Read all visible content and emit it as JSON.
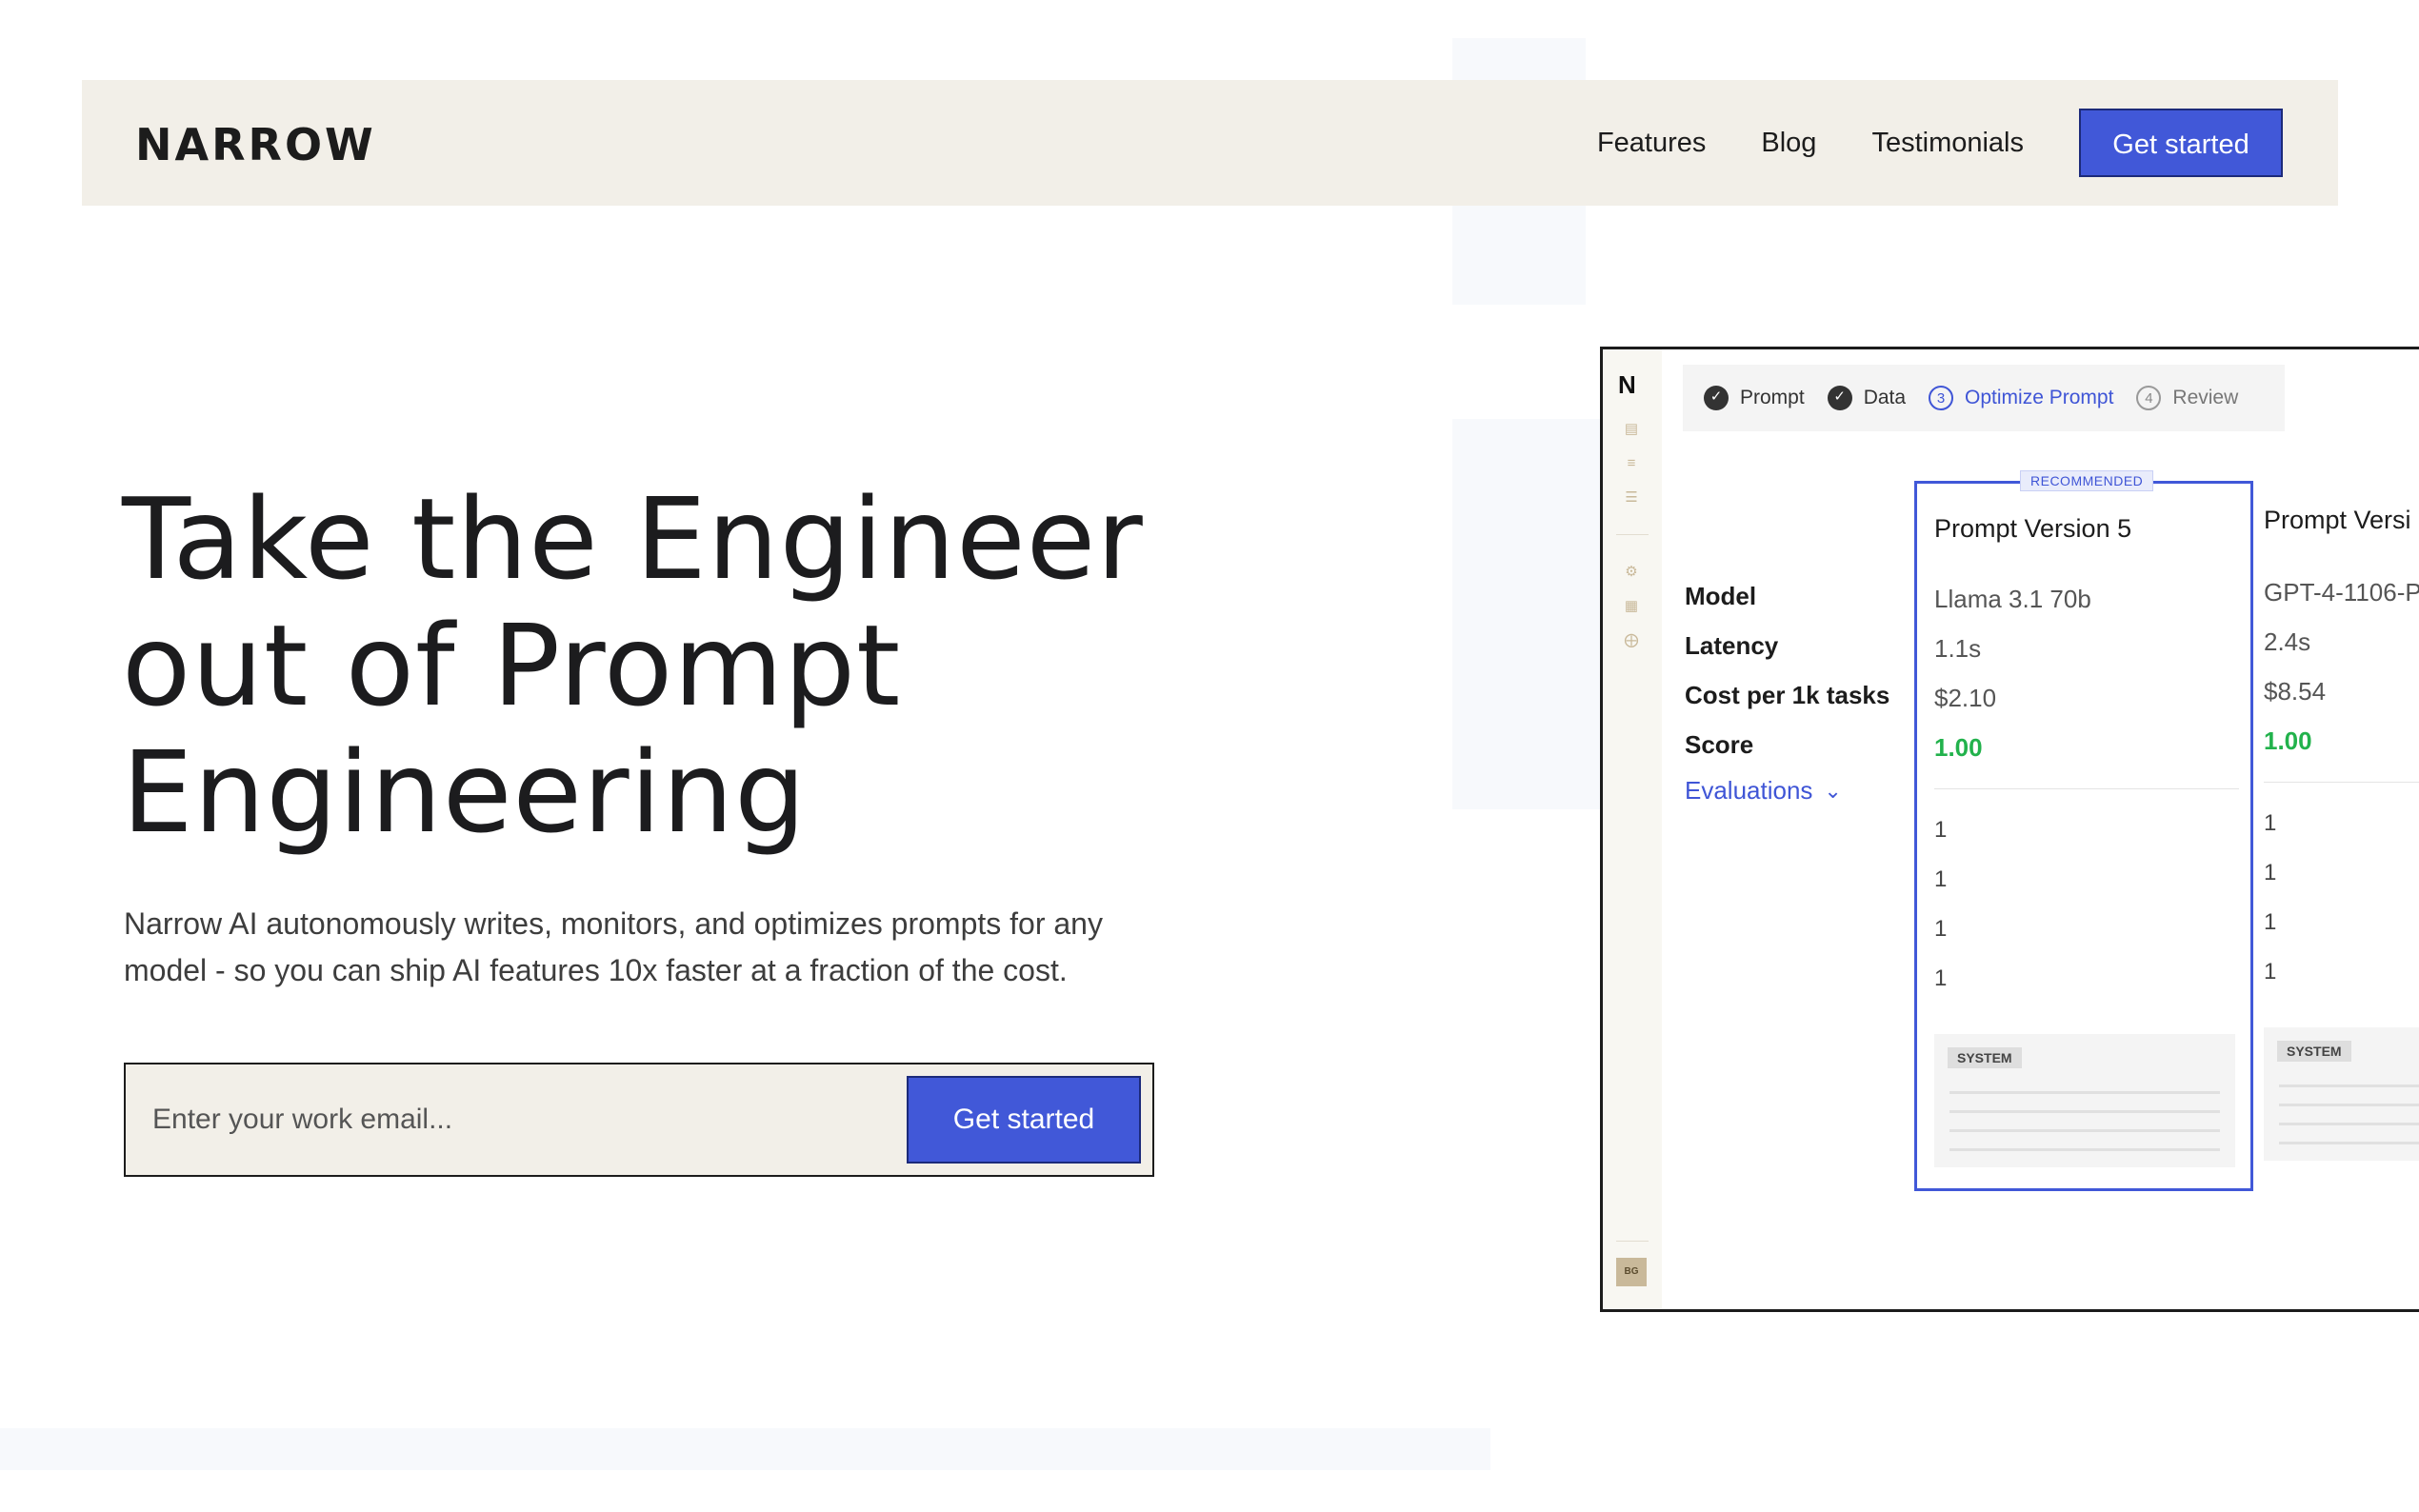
{
  "header": {
    "logo_text": "NARROW",
    "nav": [
      "Features",
      "Blog",
      "Testimonials"
    ],
    "cta_label": "Get started"
  },
  "hero": {
    "title_lines": [
      "Take the Engineer",
      "out of Prompt",
      "Engineering"
    ],
    "subtitle": "Narrow AI autonomously writes, monitors, and optimizes prompts for any model - so you can ship AI features 10x faster at a fraction of the cost.",
    "email_placeholder": "Enter your work email...",
    "email_button": "Get started"
  },
  "app": {
    "sidebar_logo": "N",
    "avatar": "BG",
    "steps": [
      {
        "label": "Prompt",
        "state": "done",
        "mark": "✓"
      },
      {
        "label": "Data",
        "state": "done",
        "mark": "✓"
      },
      {
        "label": "Optimize Prompt",
        "state": "active",
        "mark": "3"
      },
      {
        "label": "Review",
        "state": "todo",
        "mark": "4"
      }
    ],
    "row_labels": [
      "Model",
      "Latency",
      "Cost per 1k tasks",
      "Score"
    ],
    "evaluations_label": "Evaluations",
    "cards": [
      {
        "badge": "RECOMMENDED",
        "title": "Prompt Version 5",
        "model": "Llama 3.1 70b",
        "latency": "1.1s",
        "cost": "$2.10",
        "score": "1.00",
        "evals": [
          "1",
          "1",
          "1",
          "1"
        ],
        "system_label": "SYSTEM"
      },
      {
        "title": "Prompt Versi",
        "model": "GPT-4-1106-P",
        "latency": "2.4s",
        "cost": "$8.54",
        "score": "1.00",
        "evals": [
          "1",
          "1",
          "1",
          "1"
        ],
        "system_label": "SYSTEM"
      }
    ]
  },
  "colors": {
    "accent": "#4158d8",
    "header_bg": "#f2efe8",
    "score_green": "#22b24c",
    "text_dark": "#1c1c1e"
  }
}
